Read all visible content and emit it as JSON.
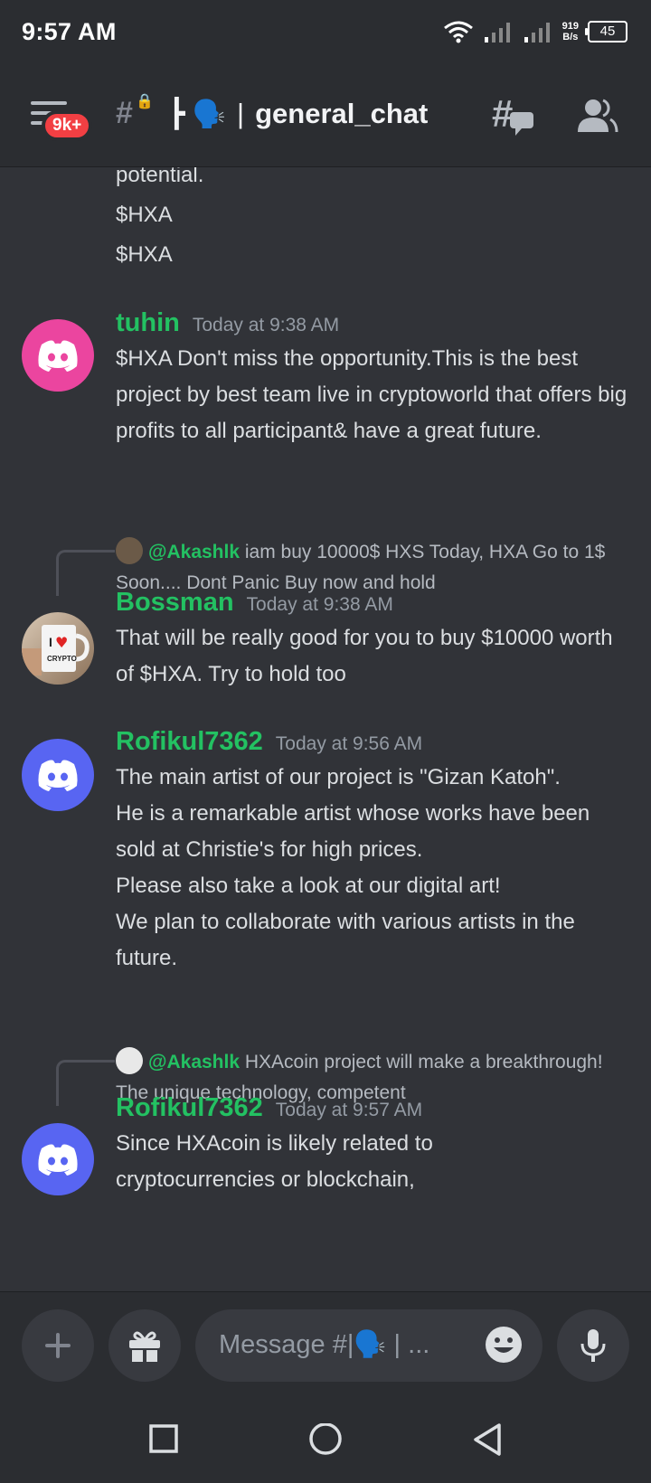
{
  "status_bar": {
    "time": "9:57 AM",
    "net_speed_value": "919",
    "net_speed_unit": "B/s",
    "battery": "45",
    "icons": [
      "wifi-icon",
      "signal-icon",
      "signal-icon",
      "battery-icon"
    ]
  },
  "header": {
    "unread_badge": "9k+",
    "channel_emojis": "🗣️",
    "channel_name": "general_chat",
    "icons": [
      "hamburger-icon",
      "locked-channel-hash-icon",
      "threads-icon",
      "members-icon"
    ]
  },
  "messages": {
    "continuation": [
      "potential.",
      "$HXA",
      "$HXA"
    ],
    "m1": {
      "username": "tuhin",
      "timestamp": "Today at 9:38 AM",
      "text": "$HXA Don't miss the opportunity.This is the best project by best team live in cryptoworld that offers big profits to all participant& have a great future."
    },
    "m2": {
      "reply_mention": "@Akashlk",
      "reply_text": "iam buy 10000$ HXS Today, HXA Go to 1$ Soon.... Dont Panic Buy now and hold",
      "username": "Bossman",
      "timestamp": "Today at 9:38 AM",
      "avatar_label": "I ♥ CRYPTO",
      "text": "That will be really good for you to buy $10000 worth of $HXA. Try to hold too"
    },
    "m3": {
      "username": "Rofikul7362",
      "timestamp": "Today at 9:56 AM",
      "lines": [
        "The main artist of our project is \"Gizan Katoh\".",
        "He is a remarkable artist whose works have been sold at Christie's for high prices.",
        "Please also take a look at our digital art!",
        "We plan to collaborate with various artists in the future."
      ]
    },
    "m4": {
      "reply_mention": "@Akashlk",
      "reply_text": "HXAcoin project will make a breakthrough! The unique technology, competent",
      "username": "Rofikul7362",
      "timestamp": "Today at 9:57 AM",
      "text": "Since HXAcoin is likely related to cryptocurrencies or blockchain,"
    }
  },
  "composer": {
    "placeholder": "Message #|🗣️ | ...",
    "icons": [
      "plus-icon",
      "gift-icon",
      "emoji-icon",
      "microphone-icon"
    ]
  },
  "nav": {
    "icons": [
      "recents-square-icon",
      "home-circle-icon",
      "back-triangle-icon"
    ]
  },
  "colors": {
    "background": "#313338",
    "header": "#2b2d31",
    "username_green": "#23c162",
    "discord_blurple": "#5865f2",
    "pink_avatar": "#eb459f",
    "badge_red": "#f23f43"
  }
}
